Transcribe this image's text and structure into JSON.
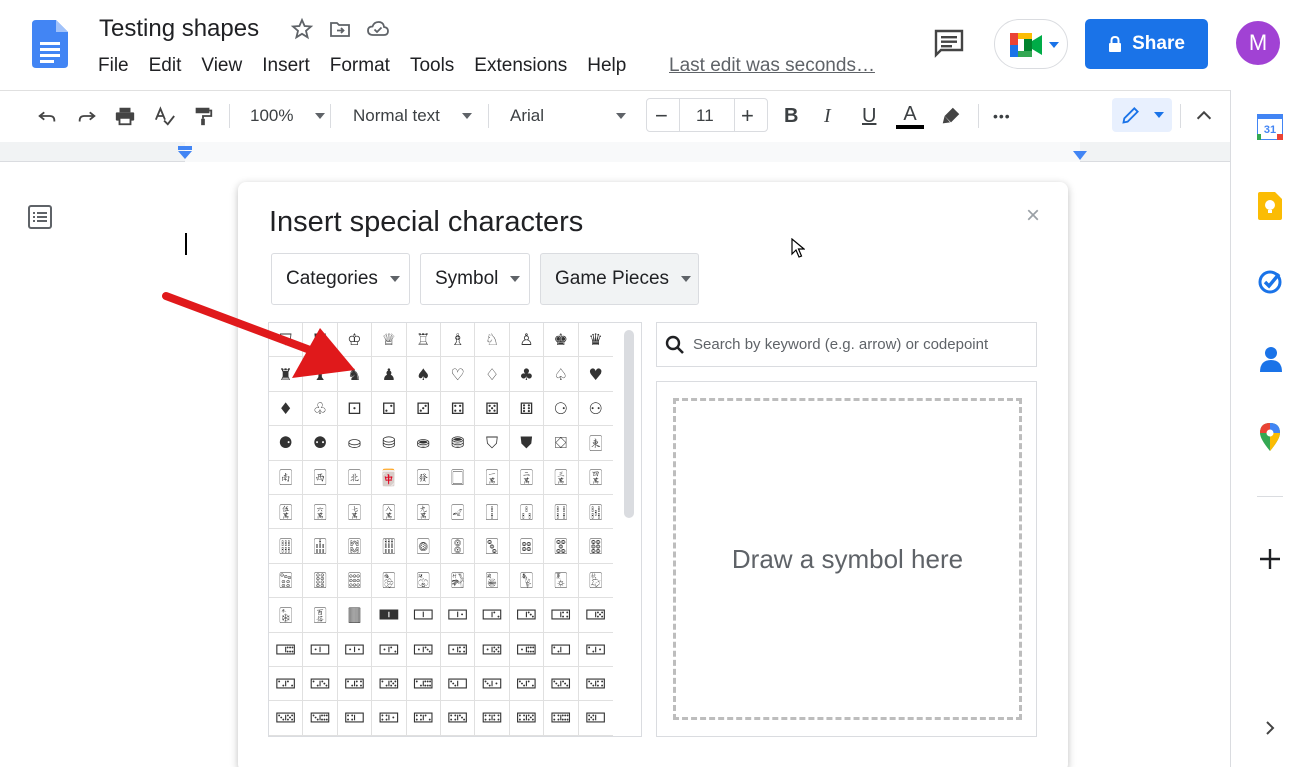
{
  "doc": {
    "title": "Testing shapes",
    "menu": [
      "File",
      "Edit",
      "View",
      "Insert",
      "Format",
      "Tools",
      "Extensions",
      "Help"
    ],
    "last_edit": "Last edit was seconds…",
    "share_label": "Share",
    "avatar_letter": "M"
  },
  "toolbar": {
    "zoom": "100%",
    "style": "Normal text",
    "font": "Arial",
    "font_size": "11",
    "bold": "B",
    "italic": "I",
    "underline": "U",
    "text_color": "A",
    "more": "•••"
  },
  "dialog": {
    "title": "Insert special characters",
    "close": "×",
    "dropdown_category": "Categories",
    "dropdown_symbol": "Symbol",
    "dropdown_game": "Game Pieces",
    "search_placeholder": "Search by keyword (e.g. arrow) or codepoint",
    "draw_label": "Draw a symbol here"
  },
  "grid_symbols": [
    "⛉",
    "⛊",
    "♔",
    "♕",
    "♖",
    "♗",
    "♘",
    "♙",
    "♚",
    "♛",
    "♜",
    "♝",
    "♞",
    "♟",
    "♠",
    "♡",
    "♢",
    "♣",
    "♤",
    "♥",
    "♦",
    "♧",
    "⚀",
    "⚁",
    "⚂",
    "⚃",
    "⚄",
    "⚅",
    "⚆",
    "⚇",
    "⚈",
    "⚉",
    "⛀",
    "⛁",
    "⛂",
    "⛃",
    "⛉",
    "⛊",
    "⛋",
    "🀀",
    "🀁",
    "🀂",
    "🀃",
    "🀄",
    "🀅",
    "🀆",
    "🀇",
    "🀈",
    "🀉",
    "🀊",
    "🀋",
    "🀌",
    "🀍",
    "🀎",
    "🀏",
    "🀐",
    "🀑",
    "🀒",
    "🀓",
    "🀔",
    "🀕",
    "🀖",
    "🀗",
    "🀘",
    "🀙",
    "🀚",
    "🀛",
    "🀜",
    "🀝",
    "🀞",
    "🀟",
    "🀠",
    "🀡",
    "🀢",
    "🀣",
    "🀤",
    "🀥",
    "🀦",
    "🀧",
    "🀨",
    "🀩",
    "🀪",
    "🀫",
    "🀰",
    "🀱",
    "🀲",
    "🀳",
    "🀴",
    "🀵",
    "🀶",
    "🀷",
    "🀸",
    "🀹",
    "🀺",
    "🀻",
    "🀼",
    "🀽",
    "🀾",
    "🀿",
    "🁀",
    "🁁",
    "🁂",
    "🁃",
    "🁄",
    "🁅",
    "🁆",
    "🁇",
    "🁈",
    "🁉",
    "🁊",
    "🁋",
    "🁌",
    "🁍",
    "🁎",
    "🁏",
    "🁐",
    "🁑",
    "🁒",
    "🁓",
    "🁔"
  ],
  "colors": {
    "accent": "#1a73e8",
    "avatar": "#a142d4",
    "arrow": "#e0191b"
  }
}
